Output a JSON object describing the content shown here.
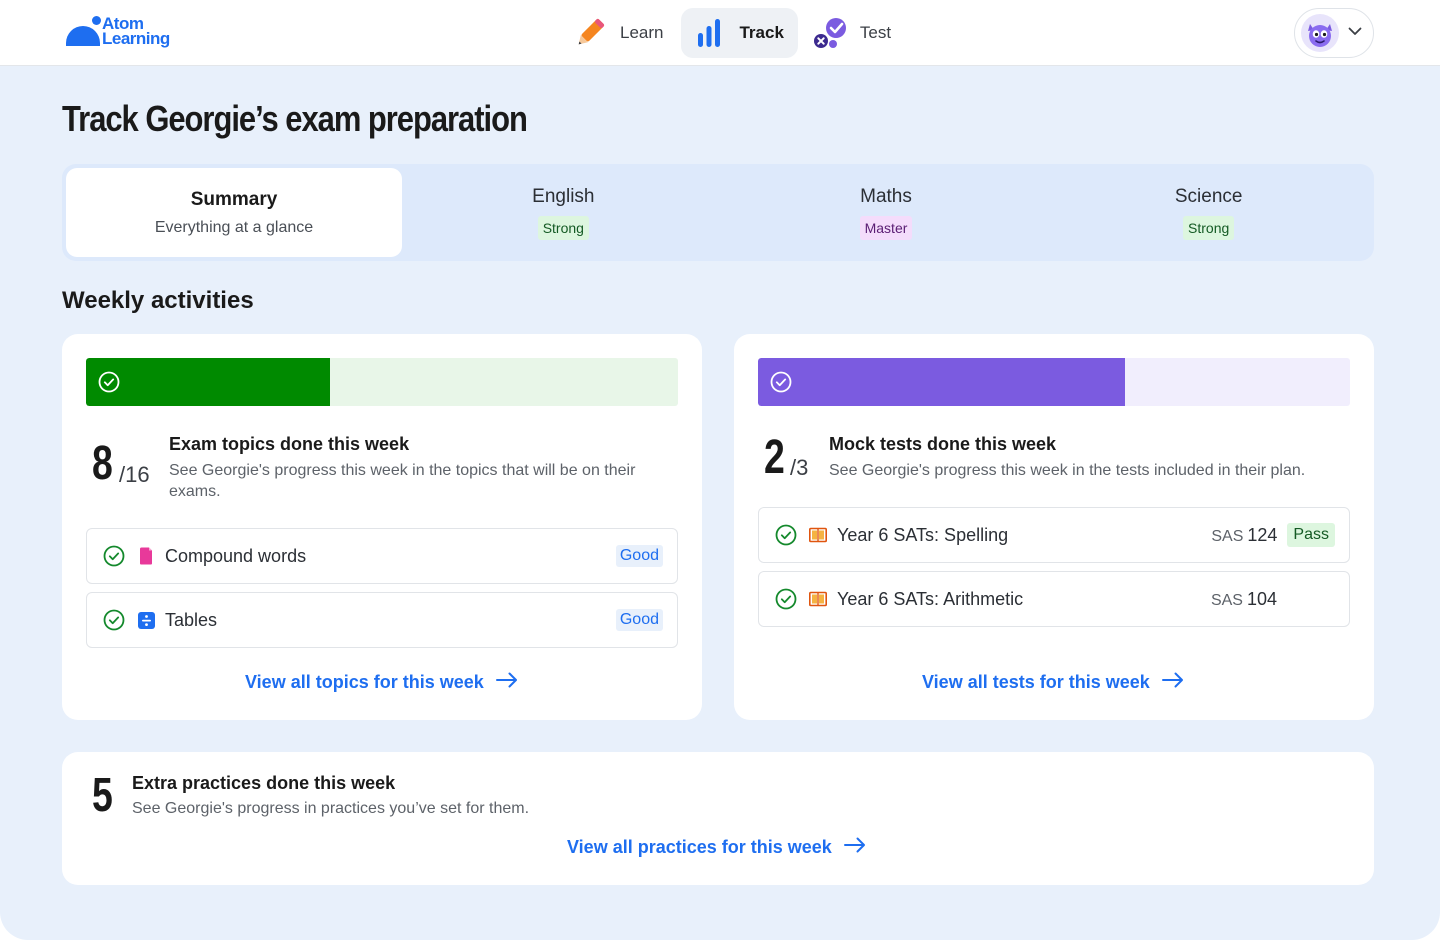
{
  "brand": {
    "line1": "Atom",
    "line2": "Learning"
  },
  "nav": [
    {
      "label": "Learn"
    },
    {
      "label": "Track"
    },
    {
      "label": "Test"
    }
  ],
  "page": {
    "title": "Track Georgie’s exam preparation"
  },
  "tabs": {
    "summary": {
      "title": "Summary",
      "subtitle": "Everything at a glance"
    },
    "english": {
      "title": "English",
      "tag": "Strong"
    },
    "maths": {
      "title": "Maths",
      "tag": "Master"
    },
    "science": {
      "title": "Science",
      "tag": "Strong"
    }
  },
  "weekly": {
    "title": "Weekly activities"
  },
  "topics": {
    "done": "8",
    "total": "/16",
    "progress_fraction": 0.5,
    "title": "Exam topics done this week",
    "description": "See Georgie's progress this week in the topics that will be on their exams.",
    "items": [
      {
        "label": "Compound words",
        "grade": "Good"
      },
      {
        "label": "Tables",
        "grade": "Good"
      }
    ],
    "link": "View all topics for this week"
  },
  "tests": {
    "done": "2",
    "total": "/3",
    "progress_fraction": 0.667,
    "title": "Mock tests done this week",
    "description": "See Georgie's progress this week in the tests included in their plan.",
    "items": [
      {
        "label": "Year 6 SATs: Spelling",
        "sas_label": "SAS",
        "sas_value": "124",
        "result": "Pass"
      },
      {
        "label": "Year 6 SATs: Arithmetic",
        "sas_label": "SAS",
        "sas_value": "104"
      }
    ],
    "link": "View all tests for this week"
  },
  "practices": {
    "done": "5",
    "title": "Extra practices done this week",
    "description": "See Georgie's progress in practices you’ve set for them.",
    "link": "View all practices for this week"
  },
  "colors": {
    "brand": "#1e6ef0",
    "topics_fill": "#008a00",
    "topics_track": "#e8f6e8",
    "tests_fill": "#7b5be0",
    "tests_track": "#f1eefd",
    "check": "#14892c"
  }
}
